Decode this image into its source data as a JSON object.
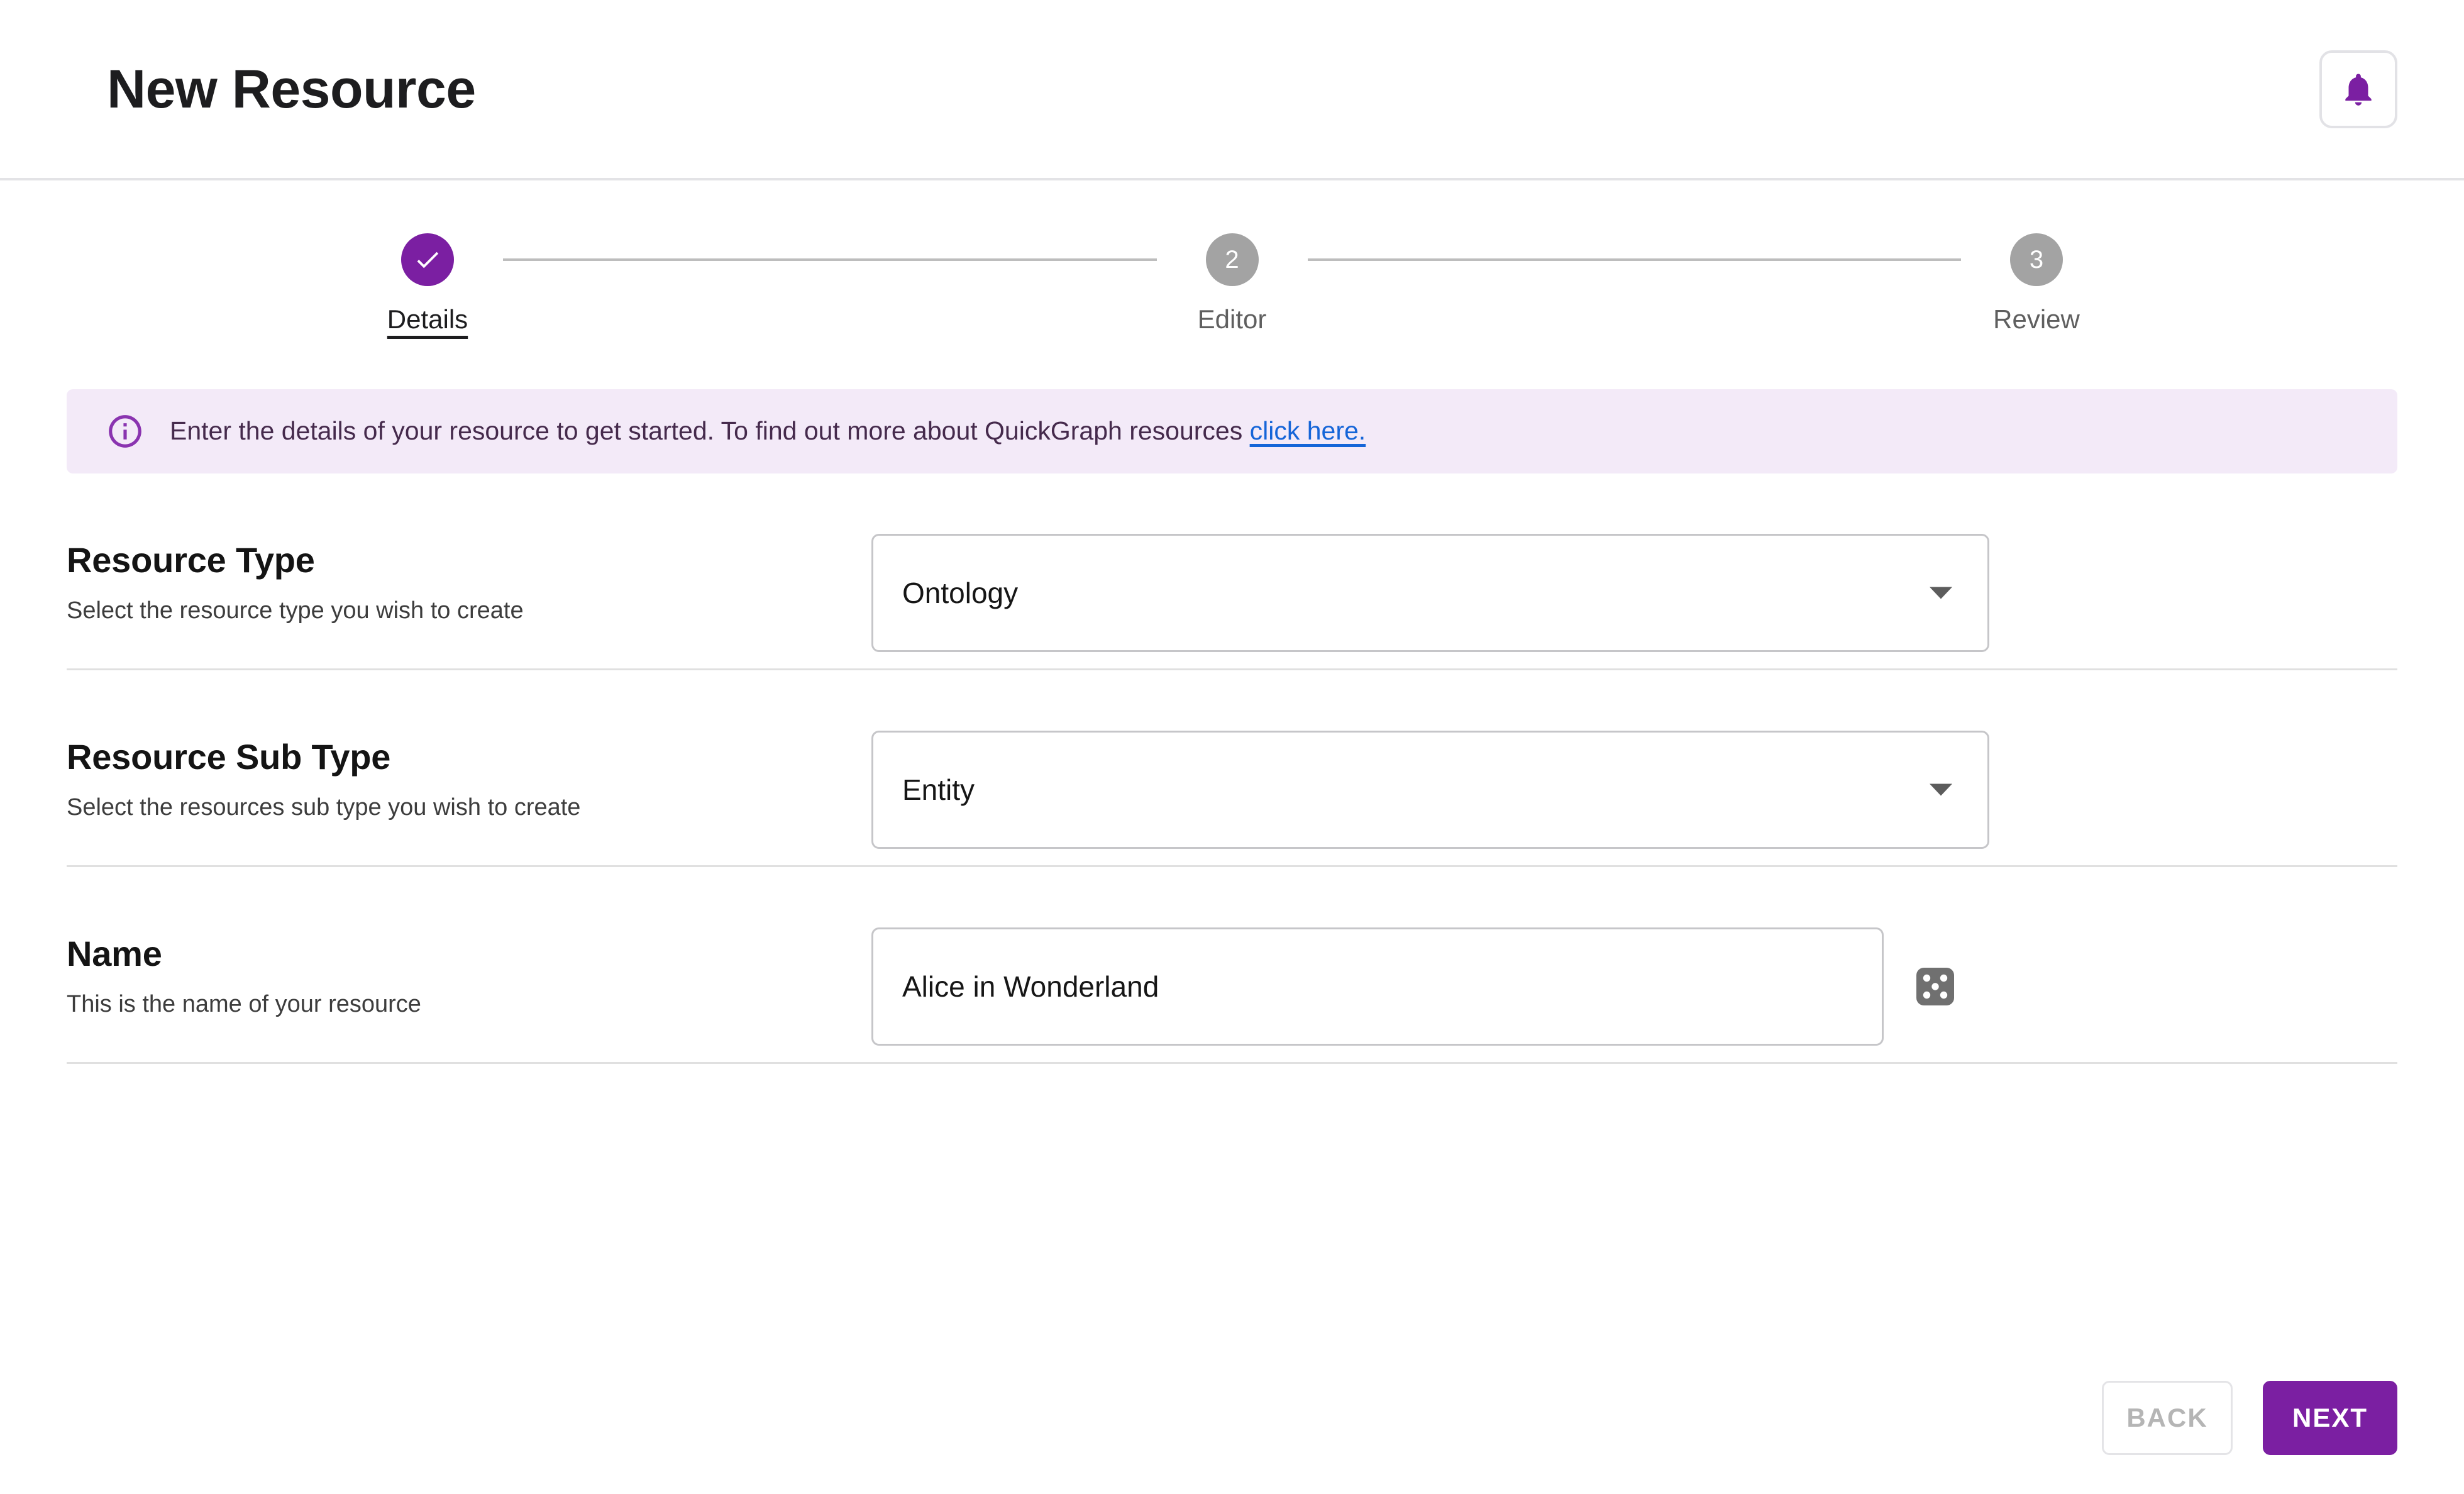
{
  "header": {
    "title": "New Resource",
    "bell_icon": "bell-icon"
  },
  "stepper": {
    "steps": [
      {
        "number": "1",
        "label": "Details",
        "state": "completed",
        "icon": "check-icon"
      },
      {
        "number": "2",
        "label": "Editor",
        "state": "upcoming"
      },
      {
        "number": "3",
        "label": "Review",
        "state": "upcoming"
      }
    ]
  },
  "banner": {
    "icon": "info-circle-icon",
    "text": "Enter the details of your resource to get started. To find out more about QuickGraph resources ",
    "link_text": "click here."
  },
  "form": {
    "resource_type": {
      "title": "Resource Type",
      "description": "Select the resource type you wish to create",
      "value": "Ontology",
      "arrow_icon": "chevron-down-icon"
    },
    "resource_sub_type": {
      "title": "Resource Sub Type",
      "description": "Select the resources sub type you wish to create",
      "value": "Entity",
      "arrow_icon": "chevron-down-icon"
    },
    "name": {
      "title": "Name",
      "description": "This is the name of your resource",
      "value": "Alice in Wonderland",
      "placeholder": "Name",
      "randomise_icon": "dice-icon"
    }
  },
  "footer": {
    "back_label": "BACK",
    "next_label": "NEXT"
  },
  "colors": {
    "accent_purple": "#7B1FA2",
    "banner_bg": "#F3EAF8",
    "banner_text": "#452A4C",
    "link_blue": "#1565D8",
    "step_inactive": "#A3A3A3",
    "border_grey": "#C6C6C9",
    "divider_grey": "#E0E0E0"
  }
}
